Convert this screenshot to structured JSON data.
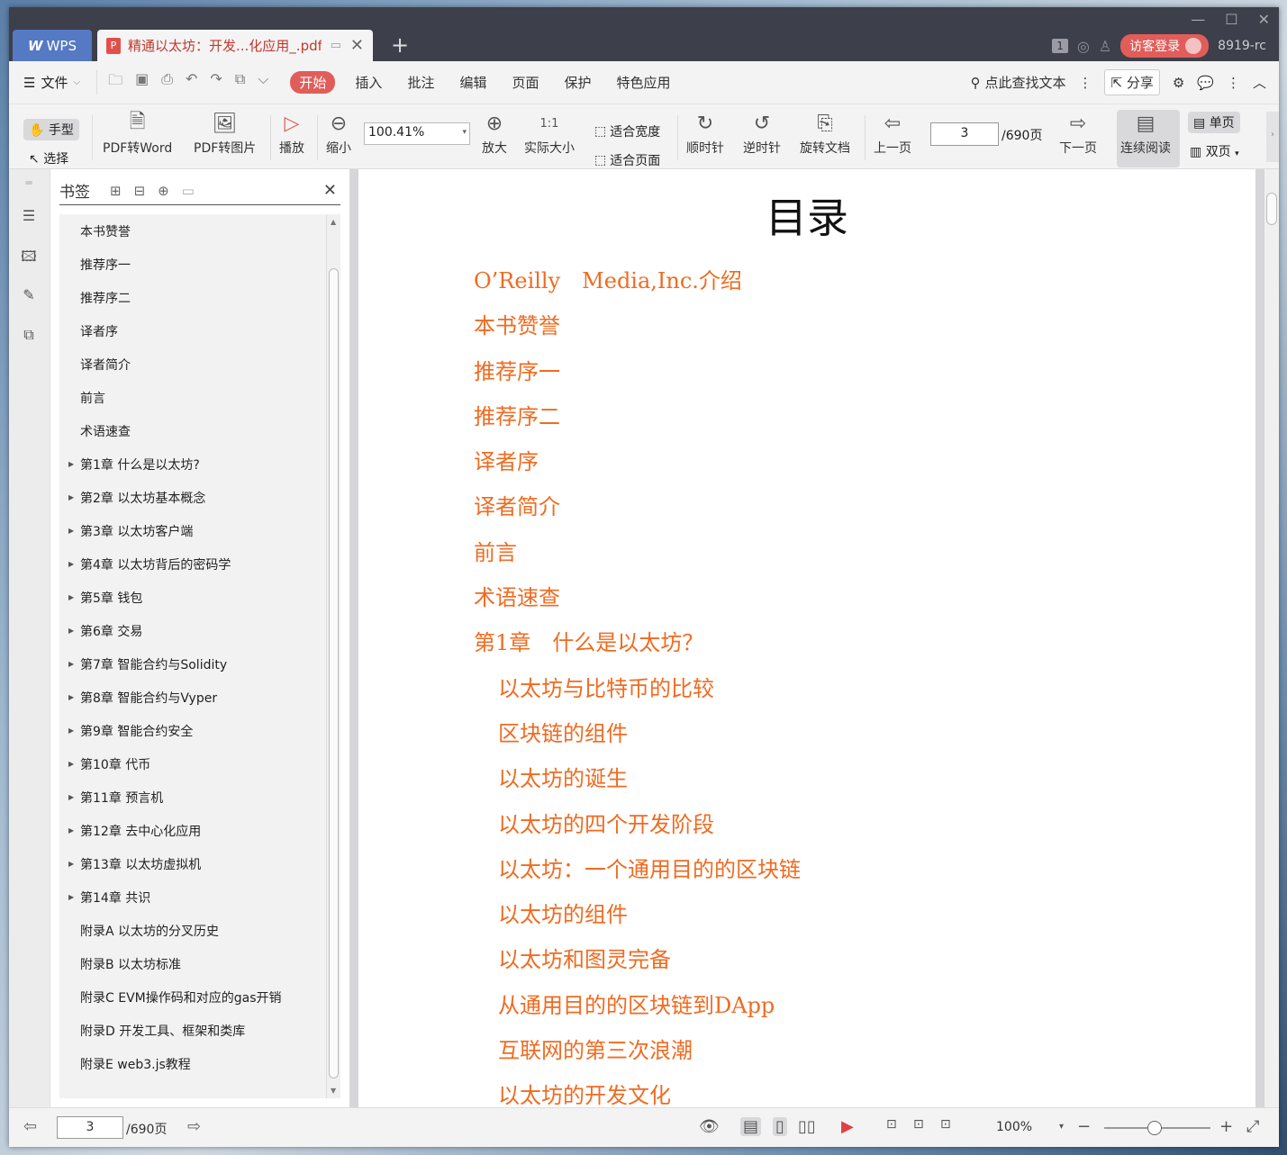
{
  "titlebar": {
    "app_tab": "WPS",
    "doc_tab": "精通以太坊：开发...化应用_.pdf",
    "page_badge": "1",
    "login_label": "访客登录",
    "version_label": "8919-rc"
  },
  "menubar": {
    "file_label": "文件",
    "tabs": [
      "开始",
      "插入",
      "批注",
      "编辑",
      "页面",
      "保护",
      "特色应用"
    ],
    "search_label": "点此查找文本",
    "share_label": "分享"
  },
  "toolbar": {
    "hand_label": "手型",
    "select_label": "选择",
    "pdf_to_word": "PDF转Word",
    "pdf_to_image": "PDF转图片",
    "play": "播放",
    "zoom_out": "缩小",
    "zoom_value": "100.41%",
    "zoom_in": "放大",
    "actual_size": "实际大小",
    "fit_width": "适合宽度",
    "fit_page": "适合页面",
    "rotate_cw": "顺时针",
    "rotate_ccw": "逆时针",
    "rotate_doc": "旋转文档",
    "prev_page": "上一页",
    "current_page": "3",
    "total_pages": "/690页",
    "next_page": "下一页",
    "continuous_read": "连续阅读",
    "single_page": "单页",
    "double_page": "双页"
  },
  "bookmark": {
    "title": "书签",
    "items": [
      {
        "label": "本书赞誉",
        "expandable": false
      },
      {
        "label": "推荐序一",
        "expandable": false
      },
      {
        "label": "推荐序二",
        "expandable": false
      },
      {
        "label": "译者序",
        "expandable": false
      },
      {
        "label": "译者简介",
        "expandable": false
      },
      {
        "label": "前言",
        "expandable": false
      },
      {
        "label": "术语速查",
        "expandable": false
      },
      {
        "label": "第1章 什么是以太坊?",
        "expandable": true
      },
      {
        "label": "第2章 以太坊基本概念",
        "expandable": true
      },
      {
        "label": "第3章 以太坊客户端",
        "expandable": true
      },
      {
        "label": "第4章 以太坊背后的密码学",
        "expandable": true
      },
      {
        "label": "第5章 钱包",
        "expandable": true
      },
      {
        "label": "第6章 交易",
        "expandable": true
      },
      {
        "label": "第7章 智能合约与Solidity",
        "expandable": true
      },
      {
        "label": "第8章 智能合约与Vyper",
        "expandable": true
      },
      {
        "label": "第9章 智能合约安全",
        "expandable": true
      },
      {
        "label": "第10章 代币",
        "expandable": true
      },
      {
        "label": "第11章 预言机",
        "expandable": true
      },
      {
        "label": "第12章 去中心化应用",
        "expandable": true
      },
      {
        "label": "第13章 以太坊虚拟机",
        "expandable": true
      },
      {
        "label": "第14章 共识",
        "expandable": true
      },
      {
        "label": "附录A 以太坊的分叉历史",
        "expandable": false
      },
      {
        "label": "附录B 以太坊标准",
        "expandable": false
      },
      {
        "label": "附录C EVM操作码和对应的gas开销",
        "expandable": false
      },
      {
        "label": "附录D 开发工具、框架和类库",
        "expandable": false
      },
      {
        "label": "附录E web3.js教程",
        "expandable": false
      }
    ]
  },
  "document": {
    "title": "目录",
    "toc": [
      {
        "text": "O’Reilly　Media,Inc.介绍",
        "sub": false
      },
      {
        "text": "本书赞誉",
        "sub": false
      },
      {
        "text": "推荐序一",
        "sub": false
      },
      {
        "text": "推荐序二",
        "sub": false
      },
      {
        "text": "译者序",
        "sub": false
      },
      {
        "text": "译者简介",
        "sub": false
      },
      {
        "text": "前言",
        "sub": false
      },
      {
        "text": "术语速查",
        "sub": false
      },
      {
        "text": "第1章　什么是以太坊？",
        "sub": false
      },
      {
        "text": "以太坊与比特币的比较",
        "sub": true
      },
      {
        "text": "区块链的组件",
        "sub": true
      },
      {
        "text": "以太坊的诞生",
        "sub": true
      },
      {
        "text": "以太坊的四个开发阶段",
        "sub": true
      },
      {
        "text": "以太坊：一个通用目的的区块链",
        "sub": true
      },
      {
        "text": "以太坊的组件",
        "sub": true
      },
      {
        "text": "以太坊和图灵完备",
        "sub": true
      },
      {
        "text": "从通用目的的区块链到DApp",
        "sub": true
      },
      {
        "text": "互联网的第三次浪潮",
        "sub": true
      },
      {
        "text": "以太坊的开发文化",
        "sub": true
      }
    ],
    "text_color": "#ef6b21"
  },
  "statusbar": {
    "current_page": "3",
    "total_pages": "/690页",
    "zoom": "100%"
  }
}
